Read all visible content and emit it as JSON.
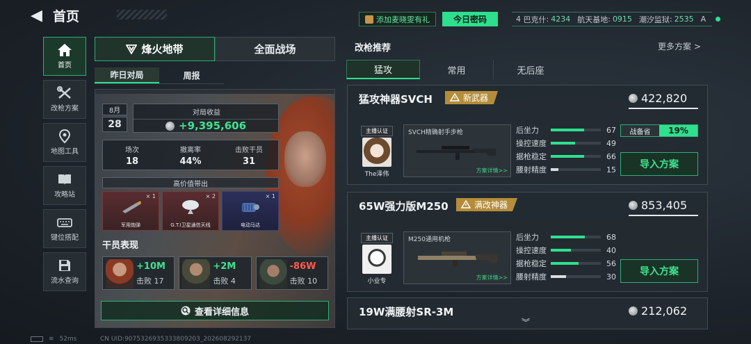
{
  "header": {
    "back_glyph": "◀",
    "title": "首页"
  },
  "topbar": {
    "gift_label": "添加麦晓雯有礼",
    "daily_code_label": "今日密码",
    "codes": [
      {
        "prefix": "4",
        "name": "巴克什",
        "value": "4234"
      },
      {
        "prefix": "",
        "name": "航天基地",
        "value": "0915"
      },
      {
        "prefix": "",
        "name": "潮汐监狱",
        "value": "2535"
      },
      {
        "prefix": "",
        "name": "A",
        "value": ""
      }
    ]
  },
  "nav": {
    "items": [
      {
        "label": "首页",
        "icon": "home-icon",
        "active": true
      },
      {
        "label": "改枪方案",
        "icon": "wrench-icon",
        "active": false
      },
      {
        "label": "地图工具",
        "icon": "map-pin-icon",
        "active": false
      },
      {
        "label": "攻略站",
        "icon": "book-icon",
        "active": false
      },
      {
        "label": "键位搭配",
        "icon": "keyboard-icon",
        "active": false
      },
      {
        "label": "流水查询",
        "icon": "save-icon",
        "active": false
      }
    ]
  },
  "modes": {
    "tab1": "烽火地带",
    "tab2": "全面战场"
  },
  "subtabs": {
    "tab1": "昨日对局",
    "tab2": "周报"
  },
  "match": {
    "month": "8月",
    "day": "28",
    "income_label": "对局收益",
    "income_value": "+9,395,606",
    "stats": [
      {
        "label": "场次",
        "value": "18"
      },
      {
        "label": "撤离率",
        "value": "44%"
      },
      {
        "label": "击败干员",
        "value": "31"
      }
    ],
    "high_value_label": "高价值带出",
    "high_value_items": [
      {
        "name": "军用炮弹",
        "count": "× 1"
      },
      {
        "name": "G.T.I卫星通信天线",
        "count": "× 2"
      },
      {
        "name": "电动马达",
        "count": "× 1"
      }
    ],
    "agent_title": "干员表现",
    "agents": [
      {
        "amount": "+10M",
        "sub": "击败 17",
        "negative": false
      },
      {
        "amount": "+2M",
        "sub": "击败 4",
        "negative": false
      },
      {
        "amount": "-86W",
        "sub": "击败 10",
        "negative": true
      }
    ],
    "detail_button": "查看详细信息"
  },
  "recommend": {
    "title": "改枪推荐",
    "more": "更多方案 >",
    "tabs": [
      "猛攻",
      "常用",
      "无后座"
    ],
    "cards": [
      {
        "name": "猛攻神器SVCH",
        "tag": "新武器",
        "price": "422,820",
        "author_badge": "主播认证",
        "author": "The泽伟",
        "gun_name": "SVCH精确射手步枪",
        "detail": "方案详情>>",
        "attrs": [
          {
            "name": "后坐力",
            "value": "67"
          },
          {
            "name": "操控速度",
            "value": "49"
          },
          {
            "name": "据枪稳定",
            "value": "66"
          },
          {
            "name": "腰射精度",
            "value": "15"
          }
        ],
        "save_label": "战备省",
        "save_value": "19%",
        "import": "导入方案"
      },
      {
        "name": "65W强力版M250",
        "tag": "满改神器",
        "price": "853,405",
        "author_badge": "主播认证",
        "author": "小业专",
        "gun_name": "M250通用机枪",
        "detail": "方案详情>>",
        "attrs": [
          {
            "name": "后坐力",
            "value": "68"
          },
          {
            "name": "操控速度",
            "value": "40"
          },
          {
            "name": "据枪稳定",
            "value": "56"
          },
          {
            "name": "腰射精度",
            "value": "30"
          }
        ],
        "import": "导入方案"
      },
      {
        "name": "19W满腰射SR-3M",
        "price": "212,062"
      }
    ]
  },
  "footer": {
    "ping": "52ms",
    "uid": "CN UID:9075326935333809203_202608292137"
  }
}
